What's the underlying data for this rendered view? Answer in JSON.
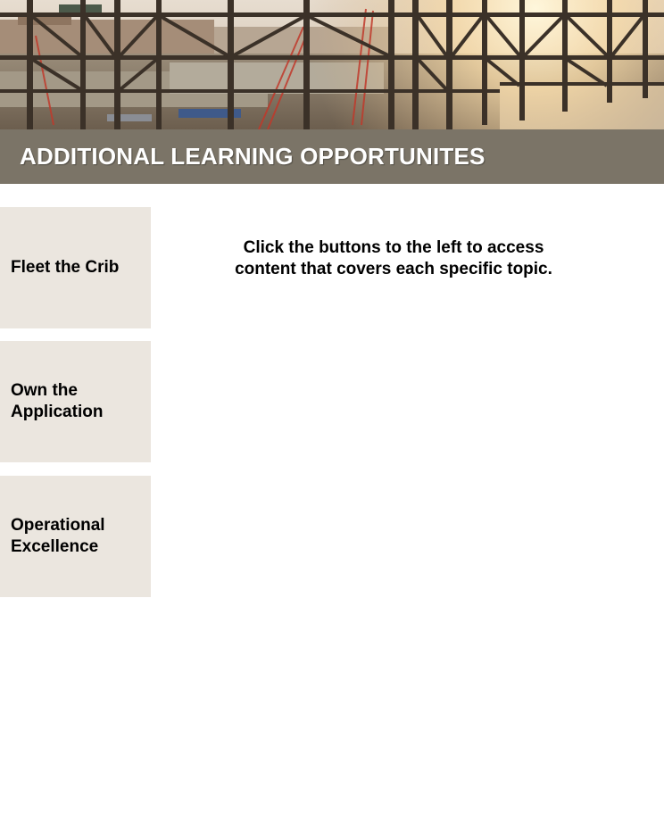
{
  "header": {
    "title": "ADDITIONAL LEARNING OPPORTUNITES"
  },
  "banner": {
    "image": "construction-site-steel-frame"
  },
  "nav": {
    "items": [
      {
        "label": "Fleet the Crib"
      },
      {
        "label": "Own the\nApplication"
      },
      {
        "label": "Operational\nExcellence"
      }
    ]
  },
  "content": {
    "instruction_line1": "Click the buttons to the left to access",
    "instruction_line2": "content that covers each specific topic."
  },
  "colors": {
    "title_bar": "#7b7467",
    "button_bg": "#ebe6df",
    "text": "#000000",
    "title_text": "#ffffff"
  }
}
